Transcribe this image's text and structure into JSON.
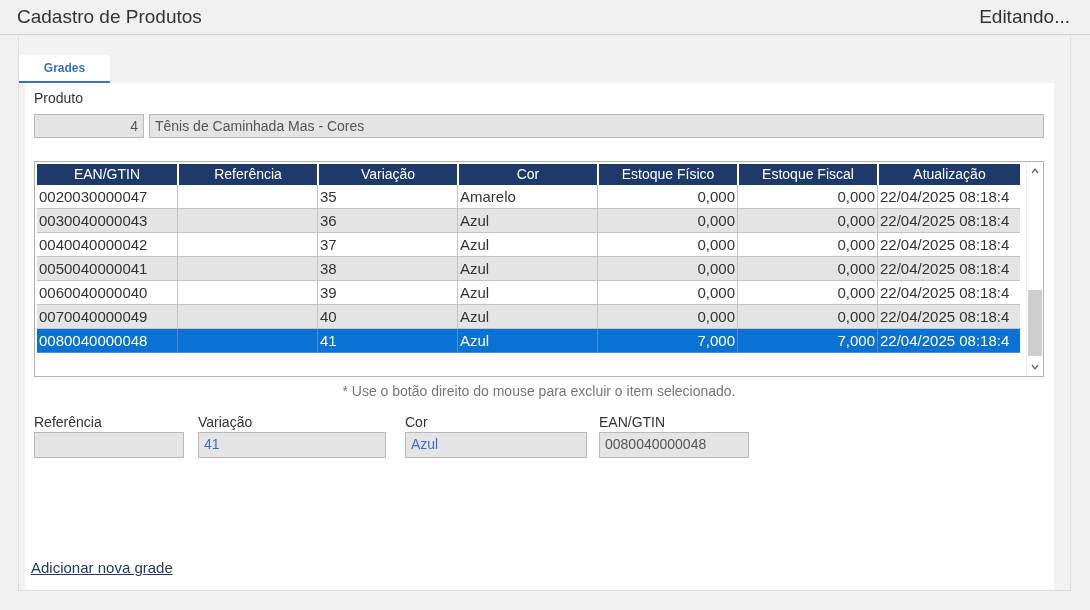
{
  "window": {
    "title": "Cadastro de Produtos",
    "status": "Editando..."
  },
  "tabs": [
    {
      "label": "Grades",
      "selected": true
    }
  ],
  "produto": {
    "label": "Produto",
    "code": "4",
    "name": "Tênis de Caminhada Mas - Cores"
  },
  "table": {
    "columns": [
      {
        "label": "EAN/GTIN",
        "kind": "text"
      },
      {
        "label": "Referência",
        "kind": "text"
      },
      {
        "label": "Variação",
        "kind": "text"
      },
      {
        "label": "Cor",
        "kind": "text"
      },
      {
        "label": "Estoque Físico",
        "kind": "number"
      },
      {
        "label": "Estoque Fiscal",
        "kind": "number"
      },
      {
        "label": "Atualização",
        "kind": "text"
      }
    ],
    "rows": [
      {
        "cells": [
          "0020030000047",
          "",
          "35",
          "Amarelo",
          "0,000",
          "0,000",
          "22/04/2025 08:18:4"
        ],
        "selected": false
      },
      {
        "cells": [
          "0030040000043",
          "",
          "36",
          "Azul",
          "0,000",
          "0,000",
          "22/04/2025 08:18:4"
        ],
        "selected": false
      },
      {
        "cells": [
          "0040040000042",
          "",
          "37",
          "Azul",
          "0,000",
          "0,000",
          "22/04/2025 08:18:4"
        ],
        "selected": false
      },
      {
        "cells": [
          "0050040000041",
          "",
          "38",
          "Azul",
          "0,000",
          "0,000",
          "22/04/2025 08:18:4"
        ],
        "selected": false
      },
      {
        "cells": [
          "0060040000040",
          "",
          "39",
          "Azul",
          "0,000",
          "0,000",
          "22/04/2025 08:18:4"
        ],
        "selected": false
      },
      {
        "cells": [
          "0070040000049",
          "",
          "40",
          "Azul",
          "0,000",
          "0,000",
          "22/04/2025 08:18:4"
        ],
        "selected": false
      },
      {
        "cells": [
          "0080040000048",
          "",
          "41",
          "Azul",
          "7,000",
          "7,000",
          "22/04/2025 08:18:4"
        ],
        "selected": true
      }
    ]
  },
  "hint": "* Use o botão direito do mouse para excluir o item selecionado.",
  "fields": [
    {
      "label": "Referência"
    },
    {
      "label": "Variação",
      "value": "41",
      "editable": true
    },
    {
      "label": "Cor",
      "value": "Azul",
      "editable": true
    },
    {
      "label": "EAN/GTIN",
      "value": "0080040000048",
      "editable": false
    }
  ],
  "link": "Adicionar nova grade"
}
